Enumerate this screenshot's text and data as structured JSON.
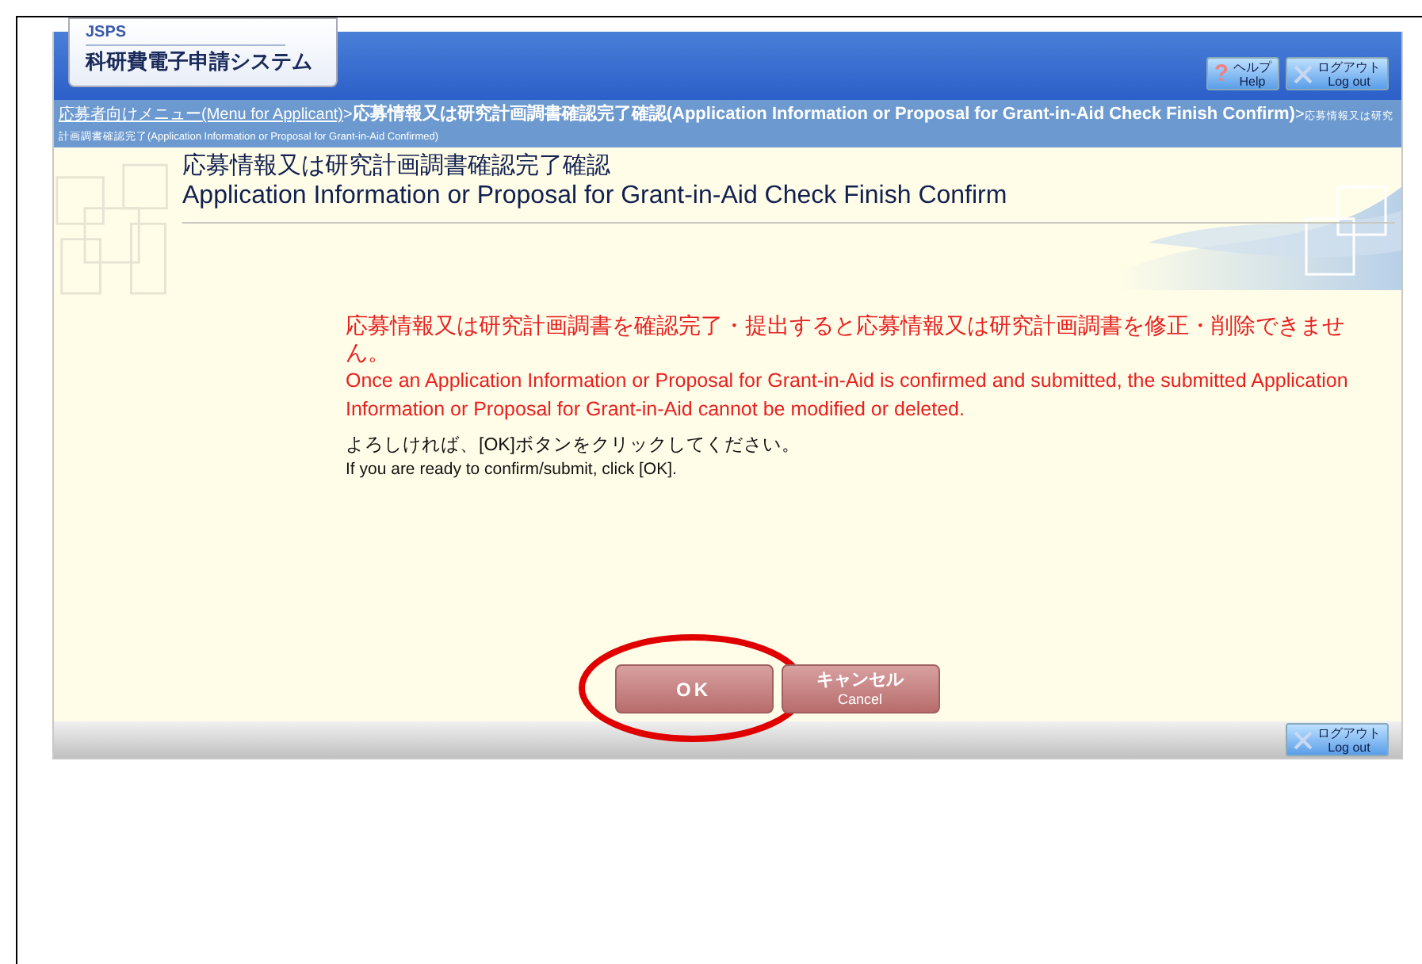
{
  "logo": {
    "org": "JSPS",
    "system": "科研費電子申請システム"
  },
  "header_buttons": [
    {
      "kind": "help",
      "icon": "?",
      "label": "ヘルプ",
      "sublabel": "Help"
    },
    {
      "kind": "logout",
      "label": "ログアウト",
      "sublabel": "Log out"
    }
  ],
  "breadcrumb": {
    "separator": ">",
    "items": [
      {
        "kind": "link",
        "text": "応募者向けメニュー(Menu for Applicant)"
      },
      {
        "kind": "bold",
        "text": "応募情報又は研究計画調書確認完了確認(Application Information or Proposal for Grant-in-Aid Check Finish Confirm)"
      },
      {
        "kind": "small",
        "text": "応募情報又は研究計画調書確認完了(Application Information or Proposal for Grant-in-Aid Confirmed)"
      }
    ]
  },
  "title": {
    "ja": "応募情報又は研究計画調書確認完了確認",
    "en": "Application Information or Proposal for Grant-in-Aid Check Finish Confirm"
  },
  "messages": [
    {
      "kind": "warning",
      "text": "応募情報又は研究計画調書を確認完了・提出すると応募情報又は研究計画調書を修正・削除できません。"
    },
    {
      "kind": "warning-en",
      "text": "Once an Application Information or Proposal for Grant-in-Aid is confirmed and submitted, the submitted Application Information or Proposal for Grant-in-Aid cannot be modified or deleted."
    },
    {
      "kind": "prompt",
      "text": "よろしければ、[OK]ボタンをクリックしてください。"
    },
    {
      "kind": "prompt-en",
      "text": "If you are ready to confirm/submit, click [OK]."
    }
  ],
  "buttons": [
    {
      "kind": "ok",
      "label": "OK",
      "highlighted": true
    },
    {
      "kind": "cancel",
      "label": "キャンセル",
      "sublabel": "Cancel",
      "highlighted": false
    }
  ],
  "footer_buttons": [
    {
      "kind": "logout",
      "label": "ログアウト",
      "sublabel": "Log out"
    }
  ]
}
